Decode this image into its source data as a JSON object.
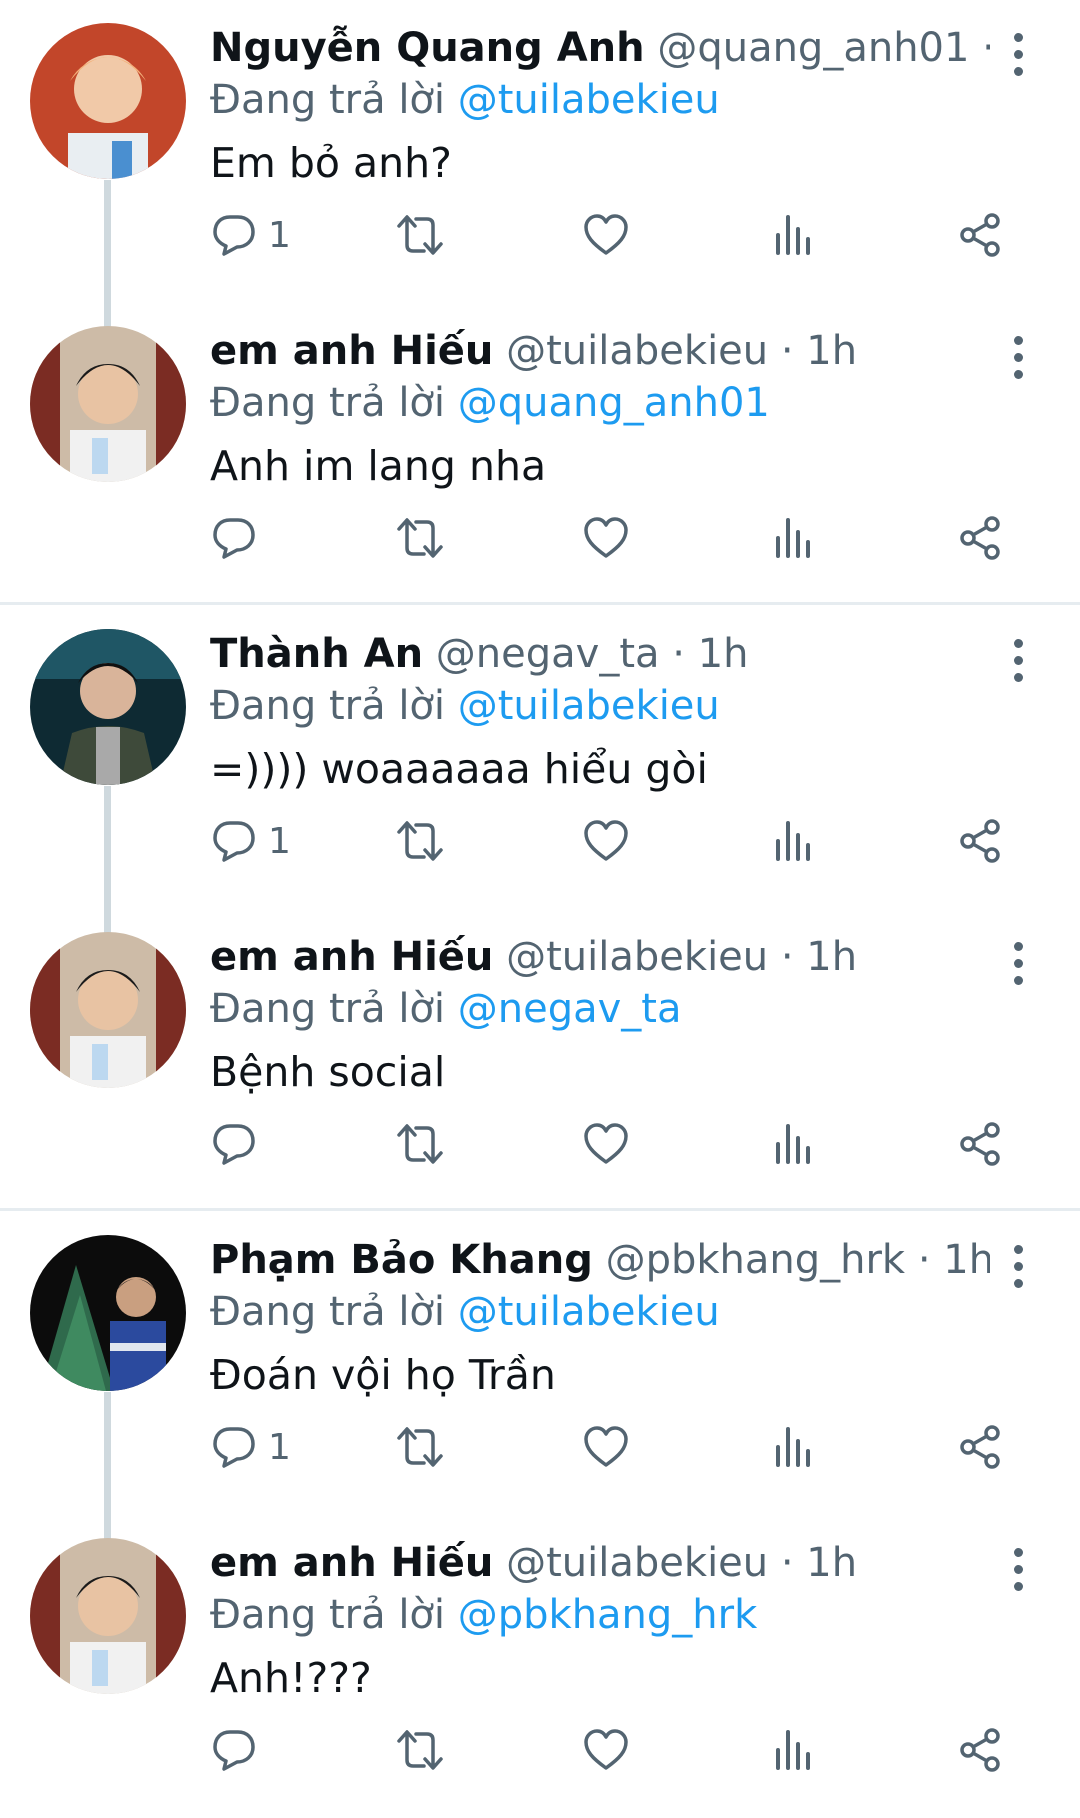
{
  "reply_prefix": "Đang trả lời",
  "tweets": [
    {
      "name": "Nguyễn Quang Anh",
      "handle": "@quang_anh01",
      "dot": "·",
      "time": "…",
      "mention": "@tuilabekieu",
      "text": "Em bỏ anh?",
      "reply_count": "1"
    },
    {
      "name": "em anh Hiếu",
      "handle": "@tuilabekieu",
      "dot": "·",
      "time": "1h",
      "mention": "@quang_anh01",
      "text": "Anh im lang nha",
      "reply_count": ""
    },
    {
      "name": "Thành An",
      "handle": "@negav_ta",
      "dot": "·",
      "time": "1h",
      "mention": "@tuilabekieu",
      "text": "=)))) woaaaaaa hiểu gòi",
      "reply_count": "1"
    },
    {
      "name": "em anh Hiếu",
      "handle": "@tuilabekieu",
      "dot": "·",
      "time": "1h",
      "mention": "@negav_ta",
      "text": "Bệnh social",
      "reply_count": ""
    },
    {
      "name": "Phạm Bảo Khang",
      "handle": "@pbkhang_hrk",
      "dot": "·",
      "time": "1h",
      "mention": "@tuilabekieu",
      "text": "Đoán vội họ Trần",
      "reply_count": "1"
    },
    {
      "name": "em anh Hiếu",
      "handle": "@tuilabekieu",
      "dot": "·",
      "time": "1h",
      "mention": "@pbkhang_hrk",
      "text": "Anh!???",
      "reply_count": ""
    }
  ],
  "icons": {
    "reply": "reply-icon",
    "retweet": "retweet-icon",
    "like": "heart-icon",
    "views": "views-icon",
    "share": "share-icon",
    "more": "more-vertical-icon"
  },
  "colors": {
    "text": "#0f1419",
    "secondary": "#536471",
    "link": "#1d9bf0",
    "thread_line": "#cfd9de",
    "separator": "#e6ecf0"
  }
}
